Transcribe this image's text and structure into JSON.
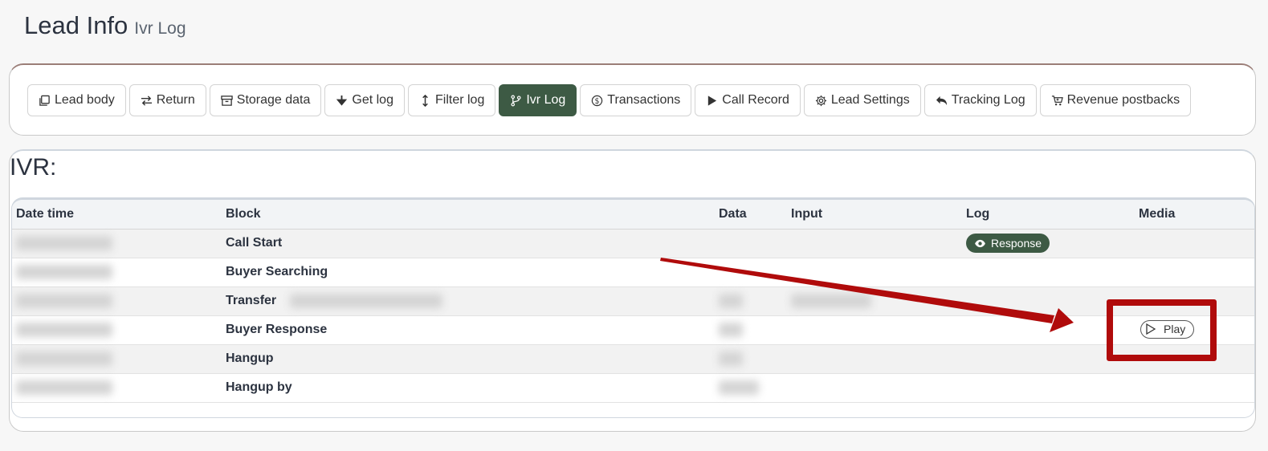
{
  "header": {
    "title": "Lead Info",
    "subtitle": "Ivr Log"
  },
  "tabs": [
    {
      "label": "Lead body",
      "icon": "copy-icon"
    },
    {
      "label": "Return",
      "icon": "swap-arrows-icon"
    },
    {
      "label": "Storage data",
      "icon": "archive-icon"
    },
    {
      "label": "Get log",
      "icon": "download-arrow-icon"
    },
    {
      "label": "Filter log",
      "icon": "vertical-arrows-icon"
    },
    {
      "label": "Ivr Log",
      "icon": "branch-icon",
      "active": true
    },
    {
      "label": "Transactions",
      "icon": "dollar-circle-icon"
    },
    {
      "label": "Call Record",
      "icon": "play-triangle-icon"
    },
    {
      "label": "Lead Settings",
      "icon": "gear-icon"
    },
    {
      "label": "Tracking Log",
      "icon": "reply-arrow-icon"
    },
    {
      "label": "Revenue postbacks",
      "icon": "cart-icon"
    }
  ],
  "ivr": {
    "title": "IVR:",
    "columns": [
      "Date time",
      "Block",
      "Data",
      "Input",
      "Log",
      "Media"
    ],
    "rows": [
      {
        "block": "Call Start",
        "log": "Response"
      },
      {
        "block": "Buyer Searching"
      },
      {
        "block": "Transfer"
      },
      {
        "block": "Buyer Response",
        "media": "Play"
      },
      {
        "block": "Hangup"
      },
      {
        "block": "Hangup by"
      }
    ]
  },
  "colors": {
    "accent_green": "#3d5a44",
    "annotation_red": "#b00b0b"
  }
}
